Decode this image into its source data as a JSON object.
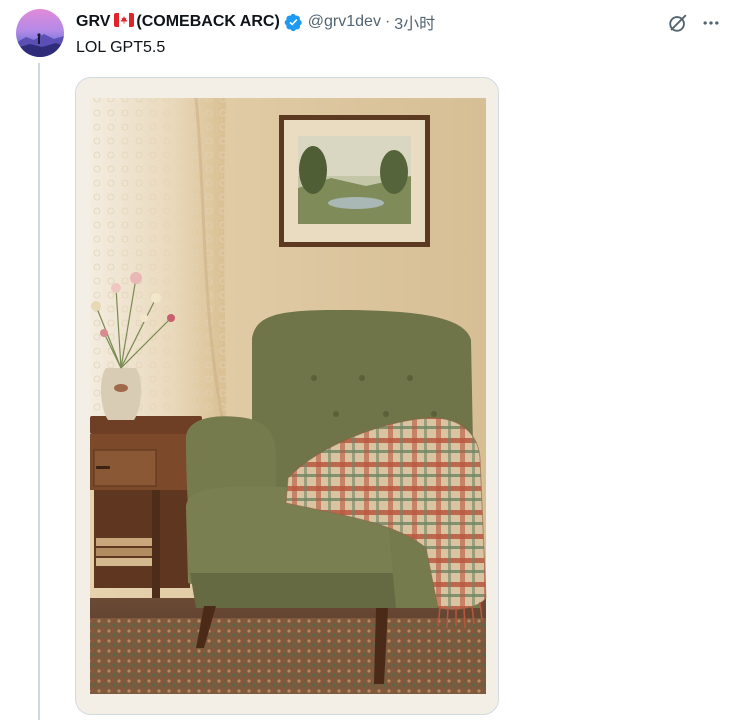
{
  "tweet": {
    "author": {
      "display_name": "GRV",
      "flag": "canada-flag-icon",
      "name_suffix": "(COMEBACK ARC)",
      "handle": "@grv1dev",
      "verified": true
    },
    "separator": "·",
    "time": "3小时",
    "text": "LOL GPT5.5",
    "media": {
      "alt": "Vintage-style photo of a green tufted armchair with a plaid blanket, a wooden side table with a vase of wildflowers, lace curtains and a framed landscape painting"
    },
    "actions": {
      "grok_icon": "grok-icon",
      "more_icon": "more-icon"
    }
  },
  "colors": {
    "text": "#0f1419",
    "secondary": "#536471",
    "verified": "#1d9bf0",
    "border": "#cfd9de"
  }
}
